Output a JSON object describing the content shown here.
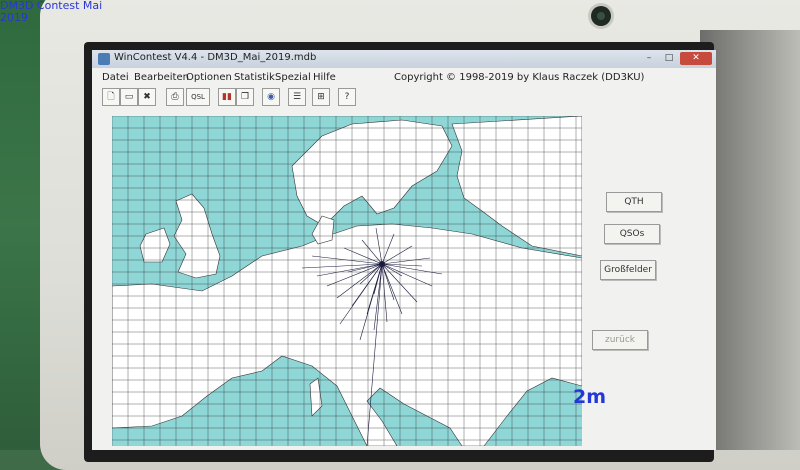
{
  "overlay": {
    "title_line1": "DM3D Contest Mai",
    "title_line2": "2019"
  },
  "window": {
    "title": "WinContest V4.4 - DM3D_Mai_2019.mdb",
    "controls": {
      "minimize": "–",
      "maximize": "□",
      "close": "✕"
    }
  },
  "menu": {
    "items": [
      "Datei",
      "Bearbeiten",
      "Optionen",
      "Statistik",
      "Spezial",
      "Hilfe"
    ],
    "copyright": "Copyright © 1998-2019 by Klaus Raczek (DD3KU)"
  },
  "toolbar": {
    "icons": [
      "new-file-icon",
      "open-folder-icon",
      "delete-icon",
      "print-icon",
      "qsl-icon",
      "books-icon",
      "copy-icon",
      "globe-icon",
      "list-icon",
      "network-icon",
      "help-icon"
    ],
    "qsl_label": "QSL"
  },
  "side_buttons": {
    "qth": "QTH",
    "qsos": "QSOs",
    "grossfelder": "Großfelder",
    "zurueck": "zurück"
  },
  "map": {
    "band": "2m",
    "sea_color": "#8fd6d7",
    "land_color": "#ffffff",
    "grid_color": "#2a2a2a"
  }
}
